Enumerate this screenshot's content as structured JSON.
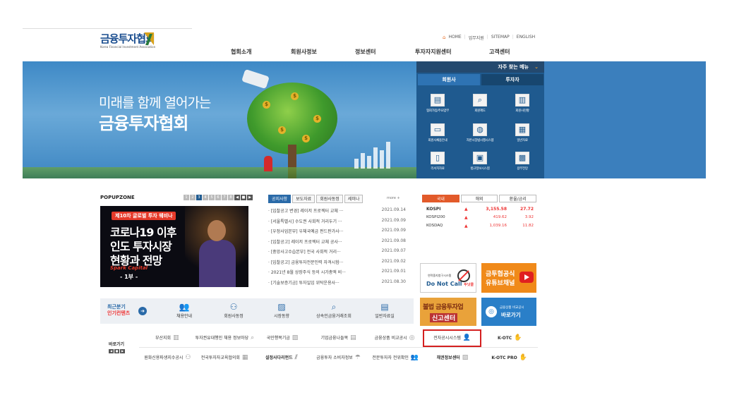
{
  "logo": {
    "name": "금융투자협회",
    "sub": "Korea Financial Investment Association"
  },
  "utility": {
    "home": "HOME",
    "items": [
      "업무지원",
      "SITEMAP",
      "ENGLISH"
    ]
  },
  "gnb": [
    "협회소개",
    "회원사정보",
    "정보센터",
    "투자자지원센터",
    "고객센터"
  ],
  "hero": {
    "line1": "미래를 함께 열어가는",
    "line2": "금융투자협회"
  },
  "quick": {
    "title": "자주 찾는 메뉴",
    "tabs": [
      "회원사",
      "투자자"
    ],
    "items": [
      {
        "icon": "book-icon",
        "label": "협회가입/주요업무"
      },
      {
        "icon": "magnifier-icon",
        "label": "회원제도"
      },
      {
        "icon": "building-icon",
        "label": "회원사현황"
      },
      {
        "icon": "monitor-icon",
        "label": "회원사채용안내"
      },
      {
        "icon": "globe-icon",
        "label": "자본시장법시행시스템"
      },
      {
        "icon": "document-icon",
        "label": "일반자료"
      },
      {
        "icon": "tablet-icon",
        "label": "리서치자료"
      },
      {
        "icon": "laptop-icon",
        "label": "법규정보시스템"
      },
      {
        "icon": "calculator-icon",
        "label": "용부전망"
      }
    ]
  },
  "popup": {
    "title": "POPUPZONE",
    "pages": [
      "1",
      "2",
      "3",
      "4",
      "5",
      "6",
      "7",
      "8"
    ],
    "badge": "제10차 글로벌 투자 웨비나",
    "line1": "코로나19 이후",
    "line2": "인도 투자시장",
    "line3": "현황과 전망",
    "sub": "Spark Capital",
    "episode": "- 1부 -"
  },
  "news": {
    "tabs": [
      "공지사항",
      "보도자료",
      "회원사동정",
      "세미나"
    ],
    "more": "more",
    "items": [
      {
        "title": "· [입찰공고 변경] 레이저 프로젝터 교체 ···",
        "date": "2021.09.14"
      },
      {
        "title": "· [서울특별시] 수도권 사회적 거리두기 ···",
        "date": "2021.09.09"
      },
      {
        "title": "· [우정사업본부] 우체국예금 펀드판가사···",
        "date": "2021.09.09"
      },
      {
        "title": "· [입찰공고] 레이저 프로젝터 교체 공사···",
        "date": "2021.09.08"
      },
      {
        "title": "· [중앙사고수습본부] 전국 사회적 거리···",
        "date": "2021.09.07"
      },
      {
        "title": "· [입찰공고] 금융투자전문인력 자격시험···",
        "date": "2021.09.02"
      },
      {
        "title": "· 2021년 8월 상장주식 등의 시가총액 비···",
        "date": "2021.09.01"
      },
      {
        "title": "· [기술보증기금] 투자일임 위탁운용사···",
        "date": "2021.08.30"
      }
    ]
  },
  "market": {
    "tabs": [
      "국내",
      "해외",
      "환율/금리"
    ],
    "rows": [
      {
        "name": "KOSPI",
        "value": "3,155.58",
        "change": "27.72"
      },
      {
        "name": "KOSPI200",
        "value": "419.62",
        "change": "3.92"
      },
      {
        "name": "KOSDAQ",
        "value": "1,039.16",
        "change": "11.82"
      }
    ]
  },
  "banners": {
    "dnc_small": "연락중지청구시스템",
    "dnc_big": "Do Not Call",
    "dnc_tag": "두낫콜",
    "yt_line1": "금투협공식",
    "yt_line2": "유튜브채널",
    "report_line1": "불법 금융투자업",
    "report_line2": "신고센터",
    "cmp_line1": "금융상품 비교공시",
    "cmp_line2": "바로가기"
  },
  "recent": {
    "line1": "최근분기",
    "line2": "인기컨텐츠",
    "items": [
      {
        "icon": "people-icon",
        "label": "채용안내"
      },
      {
        "icon": "members-icon",
        "label": "회원사동정"
      },
      {
        "icon": "chart-icon",
        "label": "시장동향"
      },
      {
        "icon": "search-person-icon",
        "label": "상속인금융거래조회"
      },
      {
        "icon": "book-icon",
        "label": "일반자료실"
      }
    ]
  },
  "shortcuts": {
    "label": "바로가기",
    "pager": [
      "◀",
      "■",
      "▶"
    ],
    "row1": [
      "부산지회",
      "투자권유대행인 채용 정보마당",
      "국민행복기금",
      "기업금융나들목",
      "금융상품 비교공시",
      "전자공시시스템",
      "K-OTC"
    ],
    "row2": [
      "원화신용파생지수공시",
      "전국투자자교육협의회",
      "설정사다리펀드",
      "금융투자 소비자정보",
      "전문투자자 전위확인",
      "채권정보센터",
      "K-OTC PRO"
    ]
  }
}
